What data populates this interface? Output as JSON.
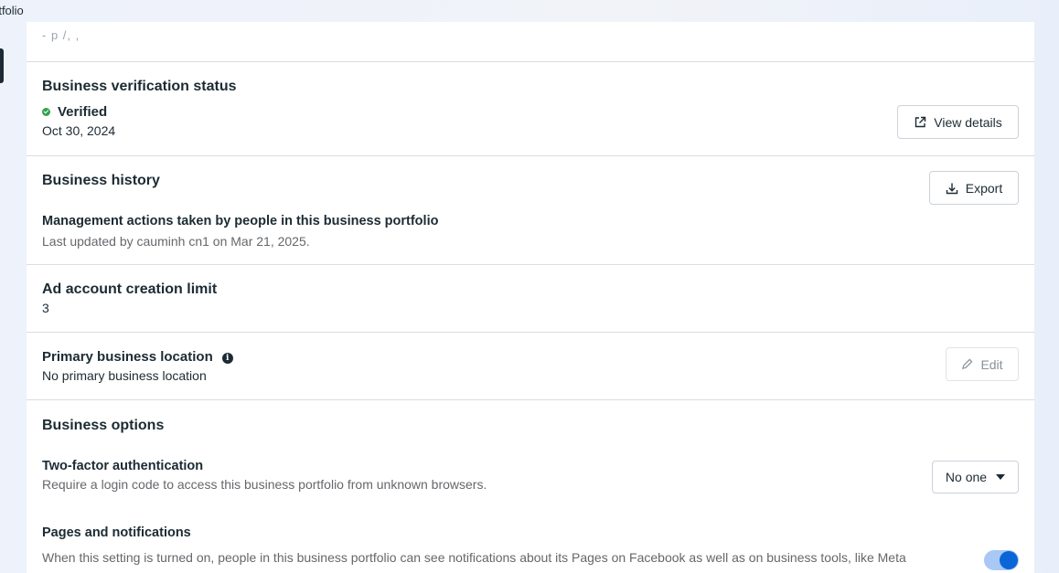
{
  "window": {
    "title_fragment": "rtfolio"
  },
  "page": {
    "truncated_line": "- p  /,                      ,",
    "verification": {
      "heading": "Business verification status",
      "status": "Verified",
      "date": "Oct 30, 2024",
      "button": "View details"
    },
    "history": {
      "heading": "Business history",
      "button": "Export",
      "subheading": "Management actions taken by people in this business portfolio",
      "updated": "Last updated by cauminh cn1 on Mar 21, 2025."
    },
    "ad_limit": {
      "heading": "Ad account creation limit",
      "value": "3"
    },
    "location": {
      "heading": "Primary business location",
      "value": "No primary business location",
      "button": "Edit"
    },
    "options": {
      "heading": "Business options",
      "two_factor": {
        "heading": "Two-factor authentication",
        "description": "Require a login code to access this business portfolio from unknown browsers.",
        "selected": "No one"
      },
      "pages_notifications": {
        "heading": "Pages and notifications",
        "description": "When this setting is turned on, people in this business portfolio can see notifications about its Pages on Facebook as well as on business tools, like Meta",
        "enabled": true
      }
    }
  },
  "colors": {
    "accent": "#0a66d8",
    "verified": "#31a24c",
    "divider": "#dadde1"
  }
}
